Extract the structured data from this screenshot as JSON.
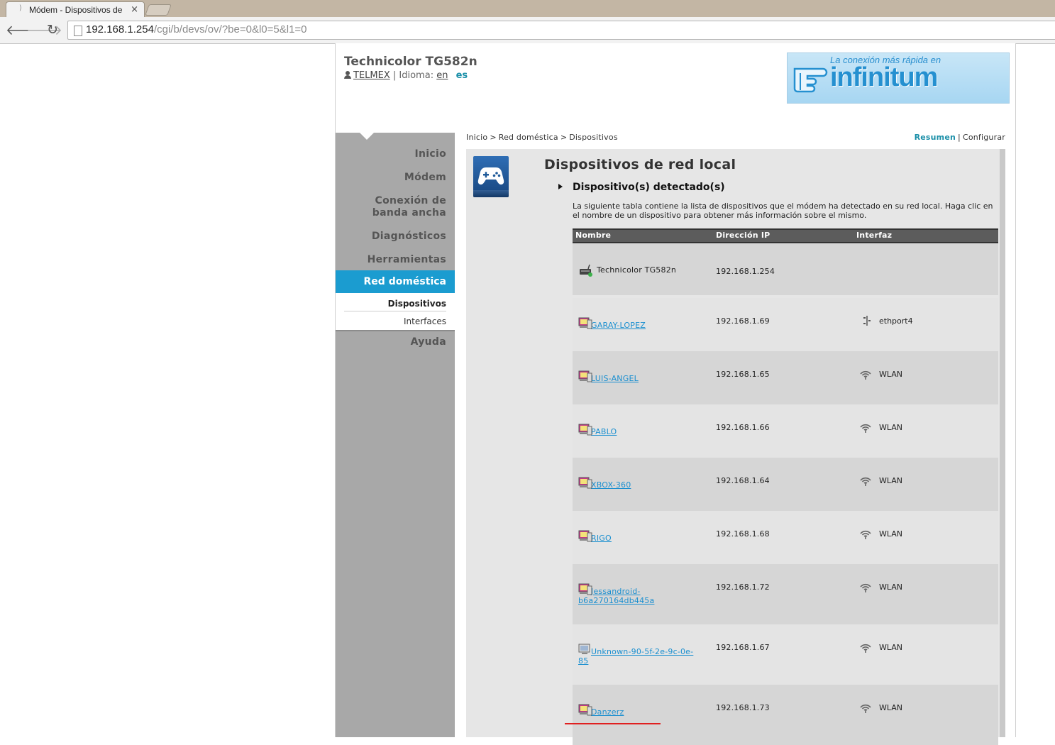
{
  "browser": {
    "tab_title": "Módem - Dispositivos de",
    "tab_close": "×",
    "url_host": "192.168.1.254",
    "url_path": "/cgi/b/devs/ov/?be=0&l0=5&l1=0"
  },
  "header": {
    "brand": "Technicolor TG582n",
    "user": "TELMEX",
    "separator": "|",
    "language_label": "Idioma:",
    "lang_en": "en",
    "lang_es": "es"
  },
  "banner": {
    "tagline": "La conexión más rápida en",
    "word": "infinitum",
    "color": "#2590d0"
  },
  "nav": {
    "items": [
      "Inicio",
      "Módem",
      "Conexión de\nbanda ancha",
      "Diagnósticos",
      "Herramientas"
    ],
    "active": "Red doméstica",
    "sub_active": "Dispositivos",
    "sub_other": "Interfaces",
    "help": "Ayuda",
    "active_color": "#1b9cd0"
  },
  "breadcrumb": {
    "home": "Inicio",
    "section": "Red doméstica",
    "page": "Dispositivos",
    "gt": ">"
  },
  "view_links": {
    "summary": "Resumen",
    "separator": "|",
    "configure": "Configurar"
  },
  "content": {
    "title": "Dispositivos de red local",
    "section_title": "Dispositivo(s) detectado(s)",
    "description": "La siguiente tabla contiene la lista de dispositivos que el módem ha detectado en su red local. Haga clic en el nombre de un dispositivo para obtener más información sobre el mismo."
  },
  "table": {
    "headers": [
      "Nombre",
      "Dirección IP",
      "Interfaz"
    ],
    "rows": [
      {
        "name": "Technicolor TG582n",
        "ip": "192.168.1.254",
        "interface": "",
        "icon": "modem-icon",
        "link": false
      },
      {
        "name": "GARAY-LOPEZ",
        "ip": "192.168.1.69",
        "interface": "ethport4",
        "icon": "pc-icon",
        "if_icon": "ethernet-icon",
        "link": true
      },
      {
        "name": "LUIS-ANGEL",
        "ip": "192.168.1.65",
        "interface": "WLAN",
        "icon": "pc-icon",
        "if_icon": "wifi-icon",
        "link": true
      },
      {
        "name": "PABLO",
        "ip": "192.168.1.66",
        "interface": "WLAN",
        "icon": "pc-icon",
        "if_icon": "wifi-icon",
        "link": true
      },
      {
        "name": "XBOX-360",
        "ip": "192.168.1.64",
        "interface": "WLAN",
        "icon": "pc-icon",
        "if_icon": "wifi-icon",
        "link": true
      },
      {
        "name": "RIGO",
        "ip": "192.168.1.68",
        "interface": "WLAN",
        "icon": "pc-icon",
        "if_icon": "wifi-icon",
        "link": true
      },
      {
        "name": "Jessandroid-\nb6a270164db445a",
        "ip": "192.168.1.72",
        "interface": "WLAN",
        "icon": "pc-icon",
        "if_icon": "wifi-icon",
        "link": true
      },
      {
        "name": "Unknown-90-5f-2e-9c-0e-\n85",
        "ip": "192.168.1.67",
        "interface": "WLAN",
        "icon": "unknown-device-icon",
        "if_icon": "wifi-icon",
        "link": true
      },
      {
        "name": "Danzerz",
        "ip": "192.168.1.73",
        "interface": "WLAN",
        "icon": "pc-icon",
        "if_icon": "wifi-icon",
        "link": true
      }
    ]
  }
}
